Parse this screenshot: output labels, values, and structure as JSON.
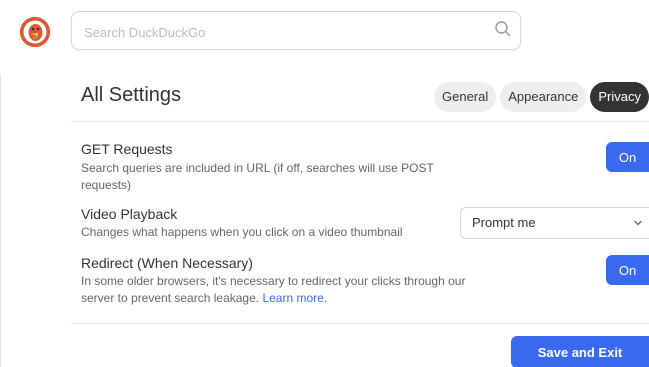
{
  "search": {
    "placeholder": "Search DuckDuckGo"
  },
  "settings_page": {
    "title": "All Settings",
    "tabs": [
      {
        "label": "General",
        "active": false
      },
      {
        "label": "Appearance",
        "active": false
      },
      {
        "label": "Privacy",
        "active": true
      }
    ],
    "items": [
      {
        "title": "GET Requests",
        "description": "Search queries are included in URL (if off, searches will use POST requests)",
        "control_label": "On"
      },
      {
        "title": "Video Playback",
        "description": "Changes what happens when you click on a video thumbnail",
        "control_value": "Prompt me"
      },
      {
        "title": "Redirect (When Necessary)",
        "description_text": "In some older browsers, it's necessary to redirect your clicks through our server to prevent search leakage.",
        "link_text": "Learn more",
        "description_end": ".",
        "control_label": "On"
      }
    ],
    "save_label": "Save and Exit"
  },
  "colors": {
    "accent": "#3969ef",
    "brand": "#de5833",
    "active_tab": "#333333",
    "tab_bg": "#eeeeee"
  },
  "icons": {
    "logo": "duckduckgo-logo-icon",
    "search": "search-icon",
    "select": "chevron-down-icon"
  }
}
